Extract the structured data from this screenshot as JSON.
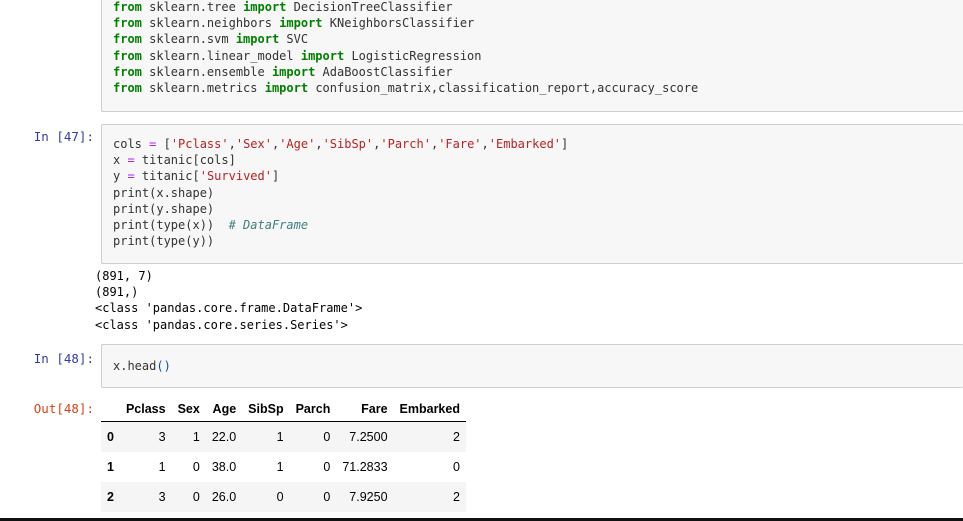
{
  "cell_imports": {
    "lines": [
      [
        {
          "k": "kw",
          "t": "from"
        },
        {
          "k": "",
          "t": " sklearn.tree "
        },
        {
          "k": "kw",
          "t": "import"
        },
        {
          "k": "",
          "t": " DecisionTreeClassifier"
        }
      ],
      [
        {
          "k": "kw",
          "t": "from"
        },
        {
          "k": "",
          "t": " sklearn.neighbors "
        },
        {
          "k": "kw",
          "t": "import"
        },
        {
          "k": "",
          "t": " KNeighborsClassifier"
        }
      ],
      [
        {
          "k": "kw",
          "t": "from"
        },
        {
          "k": "",
          "t": " sklearn.svm "
        },
        {
          "k": "kw",
          "t": "import"
        },
        {
          "k": "",
          "t": " SVC"
        }
      ],
      [
        {
          "k": "kw",
          "t": "from"
        },
        {
          "k": "",
          "t": " sklearn.linear_model "
        },
        {
          "k": "kw",
          "t": "import"
        },
        {
          "k": "",
          "t": " LogisticRegression"
        }
      ],
      [
        {
          "k": "kw",
          "t": "from"
        },
        {
          "k": "",
          "t": " sklearn.ensemble "
        },
        {
          "k": "kw",
          "t": "import"
        },
        {
          "k": "",
          "t": " AdaBoostClassifier"
        }
      ],
      [
        {
          "k": "kw",
          "t": "from"
        },
        {
          "k": "",
          "t": " sklearn.metrics "
        },
        {
          "k": "kw",
          "t": "import"
        },
        {
          "k": "",
          "t": " confusion_matrix,classification_report,accuracy_score"
        }
      ]
    ]
  },
  "cell_47": {
    "prompt": "In [47]:",
    "lines": [
      [
        {
          "k": "",
          "t": "cols "
        },
        {
          "k": "op",
          "t": "="
        },
        {
          "k": "",
          "t": " ["
        },
        {
          "k": "str",
          "t": "'Pclass'"
        },
        {
          "k": "",
          "t": ","
        },
        {
          "k": "str",
          "t": "'Sex'"
        },
        {
          "k": "",
          "t": ","
        },
        {
          "k": "str",
          "t": "'Age'"
        },
        {
          "k": "",
          "t": ","
        },
        {
          "k": "str",
          "t": "'SibSp'"
        },
        {
          "k": "",
          "t": ","
        },
        {
          "k": "str",
          "t": "'Parch'"
        },
        {
          "k": "",
          "t": ","
        },
        {
          "k": "str",
          "t": "'Fare'"
        },
        {
          "k": "",
          "t": ","
        },
        {
          "k": "str",
          "t": "'Embarked'"
        },
        {
          "k": "",
          "t": "]"
        }
      ],
      [
        {
          "k": "",
          "t": "x "
        },
        {
          "k": "op",
          "t": "="
        },
        {
          "k": "",
          "t": " titanic[cols]"
        }
      ],
      [
        {
          "k": "",
          "t": "y "
        },
        {
          "k": "op",
          "t": "="
        },
        {
          "k": "",
          "t": " titanic["
        },
        {
          "k": "str",
          "t": "'Survived'"
        },
        {
          "k": "",
          "t": "]"
        }
      ],
      [
        {
          "k": "",
          "t": "print(x.shape)"
        }
      ],
      [
        {
          "k": "",
          "t": "print(y.shape)"
        }
      ],
      [
        {
          "k": "",
          "t": "print(type(x))  "
        },
        {
          "k": "cm",
          "t": "# DataFrame"
        }
      ],
      [
        {
          "k": "",
          "t": "print(type(y))"
        }
      ]
    ],
    "output": "(891, 7)\n(891,)\n<class 'pandas.core.frame.DataFrame'>\n<class 'pandas.core.series.Series'>"
  },
  "cell_48": {
    "prompt": "In [48]:",
    "lines": [
      [
        {
          "k": "",
          "t": "x.head"
        },
        {
          "k": "paren",
          "t": "()"
        }
      ]
    ],
    "out_prompt": "Out[48]:"
  },
  "dataframe": {
    "columns": [
      "",
      "Pclass",
      "Sex",
      "Age",
      "SibSp",
      "Parch",
      "Fare",
      "Embarked"
    ],
    "rows": [
      [
        "0",
        "3",
        "1",
        "22.0",
        "1",
        "0",
        "7.2500",
        "2"
      ],
      [
        "1",
        "1",
        "0",
        "38.0",
        "1",
        "0",
        "71.2833",
        "0"
      ],
      [
        "2",
        "3",
        "0",
        "26.0",
        "0",
        "0",
        "7.9250",
        "2"
      ]
    ]
  }
}
